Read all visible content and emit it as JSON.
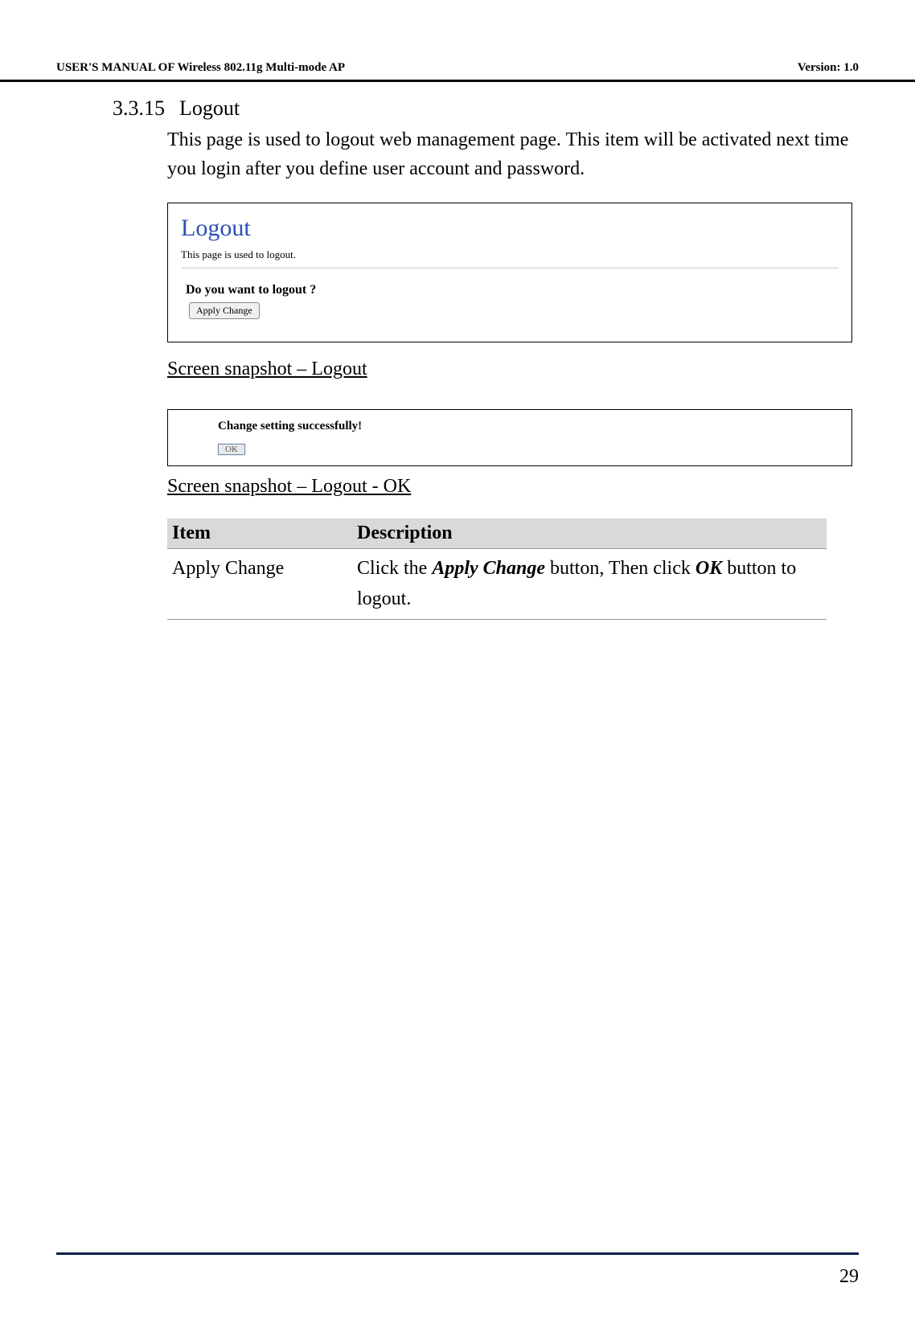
{
  "header": {
    "left": "USER'S MANUAL OF Wireless 802.11g Multi-mode AP",
    "right": "Version: 1.0"
  },
  "section": {
    "number": "3.3.15",
    "title": "Logout",
    "body": "This page is used to logout web management page. This item will be activated next time you login after you define user account and password."
  },
  "screenshot1": {
    "title": "Logout",
    "subtitle": "This page is used to logout.",
    "question": "Do you want to logout ?",
    "button": "Apply Change"
  },
  "caption1": "Screen snapshot – Logout",
  "screenshot2": {
    "message": "Change setting successfully!",
    "button": "OK"
  },
  "caption2": "Screen snapshot – Logout - OK",
  "table": {
    "headers": {
      "item": "Item",
      "description": "Description"
    },
    "rows": [
      {
        "item": "Apply Change",
        "desc_prefix": "Click the ",
        "desc_em1": "Apply Change",
        "desc_mid": " button, Then click ",
        "desc_em2": "OK",
        "desc_suffix": " button to logout."
      }
    ]
  },
  "footer": {
    "page": "29"
  }
}
